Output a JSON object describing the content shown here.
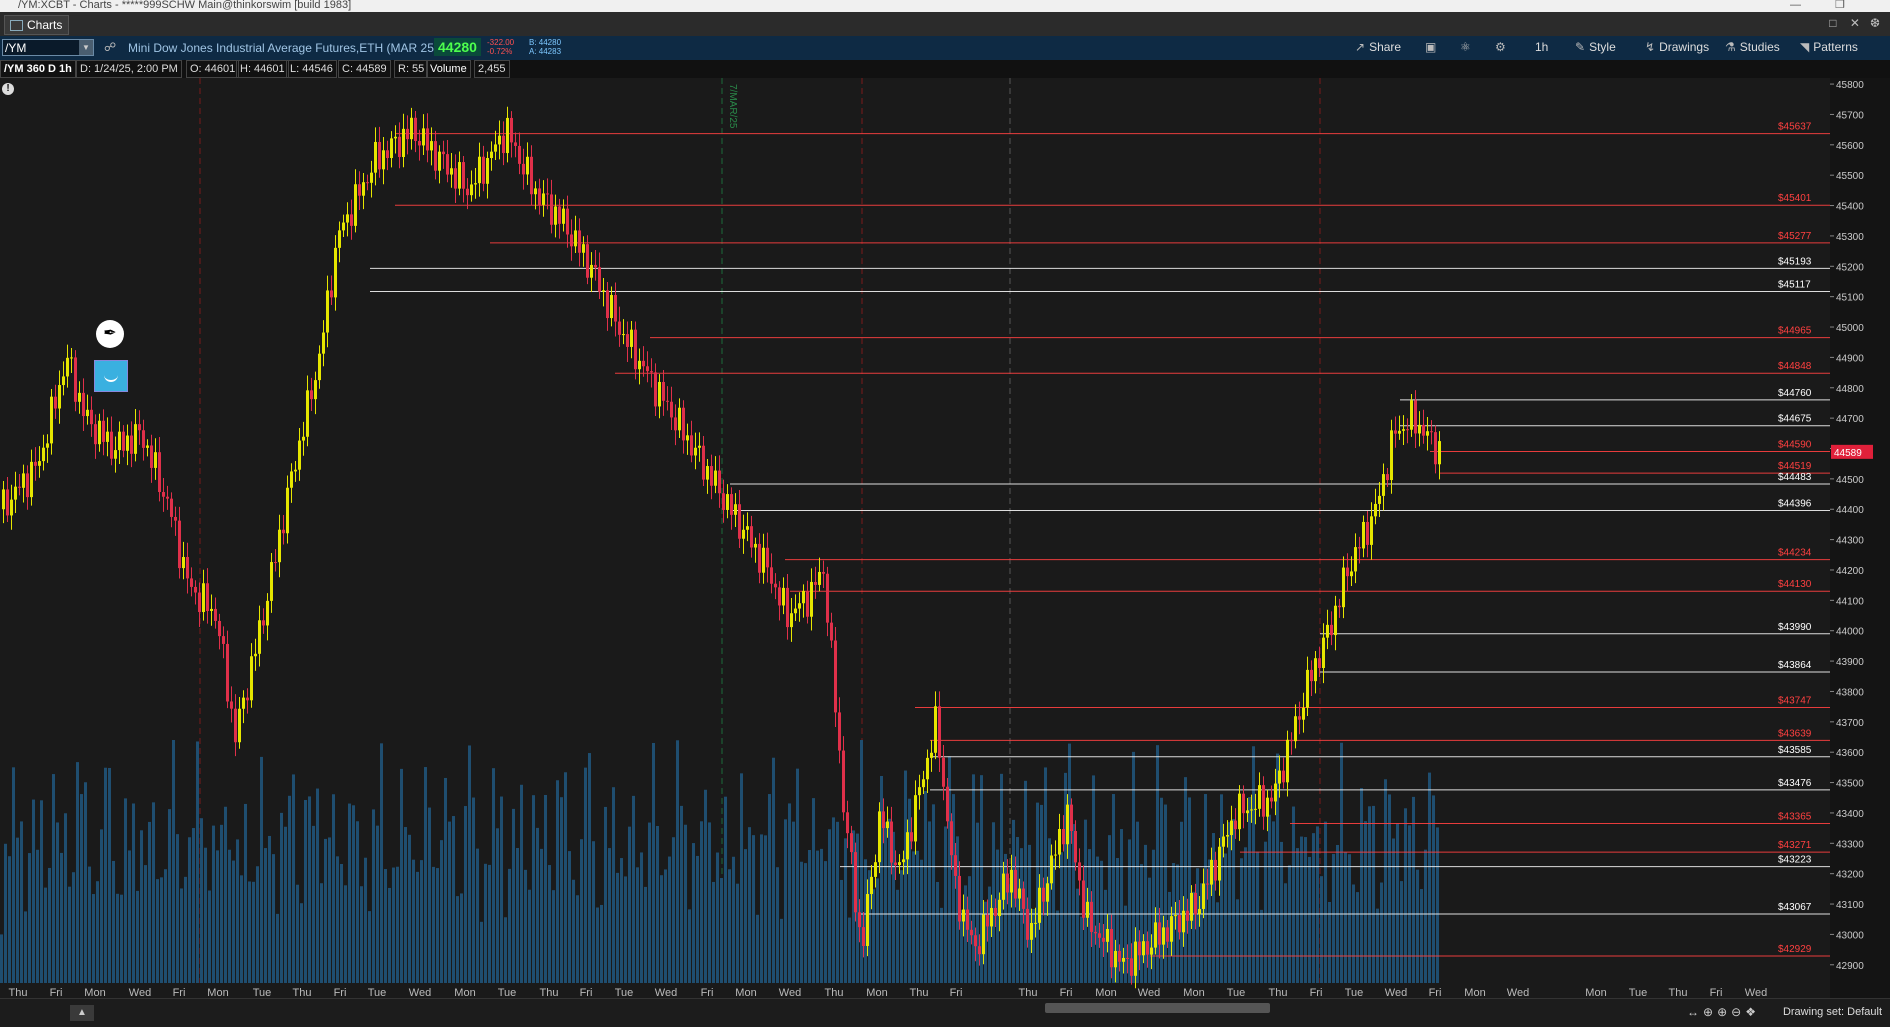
{
  "window": {
    "title": "/YM:XCBT - Charts - *****999SCHW Main@thinkorswim [build 1983]"
  },
  "tabs": [
    {
      "label": "Charts"
    }
  ],
  "toolbar": {
    "symbol": "/YM",
    "description": "Mini Dow Jones Industrial Average Futures,ETH (MAR 25)",
    "last_price": "44280",
    "net_change": "-322.00",
    "pct_change": "-0.72%",
    "bid": "B: 44280",
    "ask": "A: 44283",
    "share_label": "Share",
    "timeframe_label": "1h",
    "style_label": "Style",
    "drawings_label": "Drawings",
    "studies_label": "Studies",
    "patterns_label": "Patterns"
  },
  "status": {
    "chart_name": "/YM 360 D 1h",
    "date": "D: 1/24/25, 2:00 PM",
    "open": "O: 44601",
    "high": "H: 44601",
    "low": "L: 44546",
    "close": "C: 44589",
    "range": "R: 55",
    "volume_label": "Volume",
    "volume_value": "2,455"
  },
  "chart_data": {
    "type": "candlestick",
    "annotation": "7/MAR/25",
    "current_price": "44589",
    "ylim": [
      42840,
      45820
    ],
    "y_ticks": [
      "42900",
      "43000",
      "43100",
      "43200",
      "43300",
      "43400",
      "43500",
      "43600",
      "43700",
      "43800",
      "43900",
      "44000",
      "44100",
      "44200",
      "44300",
      "44400",
      "44500",
      "44600",
      "44700",
      "44800",
      "44900",
      "45000",
      "45100",
      "45200",
      "45300",
      "45400",
      "45500",
      "45600",
      "45700",
      "45800"
    ],
    "x_ticks": [
      "Thu",
      "Fri",
      "Mon",
      "Wed",
      "Fri",
      "Mon",
      "Tue",
      "Thu",
      "Fri",
      "Tue",
      "Wed",
      "Mon",
      "Tue",
      "Thu",
      "Fri",
      "Tue",
      "Wed",
      "Fri",
      "Mon",
      "Wed",
      "Thu",
      "Mon",
      "Thu",
      "Fri",
      "Thu",
      "Fri",
      "Mon",
      "Wed",
      "Mon",
      "Tue",
      "Thu",
      "Fri",
      "Tue",
      "Wed",
      "Fri",
      "Mon",
      "Wed",
      "Mon",
      "Tue",
      "Thu",
      "Fri",
      "Wed"
    ],
    "levels": [
      {
        "value": 45637,
        "label": "$45637",
        "color": "#ff4040"
      },
      {
        "value": 45401,
        "label": "$45401",
        "color": "#ff4040"
      },
      {
        "value": 45277,
        "label": "$45277",
        "color": "#ff4040"
      },
      {
        "value": 45193,
        "label": "$45193",
        "color": "#ffffff"
      },
      {
        "value": 45117,
        "label": "$45117",
        "color": "#ffffff"
      },
      {
        "value": 44965,
        "label": "$44965",
        "color": "#ff4040"
      },
      {
        "value": 44848,
        "label": "$44848",
        "color": "#ff4040"
      },
      {
        "value": 44760,
        "label": "$44760",
        "color": "#ffffff"
      },
      {
        "value": 44675,
        "label": "$44675",
        "color": "#ffffff"
      },
      {
        "value": 44590,
        "label": "$44590",
        "color": "#ff4040"
      },
      {
        "value": 44519,
        "label": "$44519",
        "color": "#ff4040"
      },
      {
        "value": 44483,
        "label": "$44483",
        "color": "#ffffff"
      },
      {
        "value": 44396,
        "label": "$44396",
        "color": "#ffffff"
      },
      {
        "value": 44234,
        "label": "$44234",
        "color": "#ff4040"
      },
      {
        "value": 44130,
        "label": "$44130",
        "color": "#ff4040"
      },
      {
        "value": 43990,
        "label": "$43990",
        "color": "#ffffff"
      },
      {
        "value": 43864,
        "label": "$43864",
        "color": "#ffffff"
      },
      {
        "value": 43747,
        "label": "$43747",
        "color": "#ff4040"
      },
      {
        "value": 43639,
        "label": "$43639",
        "color": "#ff4040"
      },
      {
        "value": 43585,
        "label": "$43585",
        "color": "#ffffff"
      },
      {
        "value": 43476,
        "label": "$43476",
        "color": "#ffffff"
      },
      {
        "value": 43365,
        "label": "$43365",
        "color": "#ff4040"
      },
      {
        "value": 43271,
        "label": "$43271",
        "color": "#ff4040"
      },
      {
        "value": 43223,
        "label": "$43223",
        "color": "#ffffff"
      },
      {
        "value": 43067,
        "label": "$43067",
        "color": "#ffffff"
      },
      {
        "value": 42929,
        "label": "$42929",
        "color": "#ff4040"
      }
    ],
    "price_path": [
      [
        0,
        44400
      ],
      [
        0.02,
        44550
      ],
      [
        0.035,
        44900
      ],
      [
        0.045,
        44700
      ],
      [
        0.06,
        44600
      ],
      [
        0.075,
        44650
      ],
      [
        0.09,
        44400
      ],
      [
        0.1,
        44150
      ],
      [
        0.115,
        44050
      ],
      [
        0.125,
        43650
      ],
      [
        0.14,
        44050
      ],
      [
        0.155,
        44500
      ],
      [
        0.17,
        44900
      ],
      [
        0.18,
        45300
      ],
      [
        0.2,
        45550
      ],
      [
        0.22,
        45650
      ],
      [
        0.235,
        45550
      ],
      [
        0.25,
        45450
      ],
      [
        0.27,
        45650
      ],
      [
        0.285,
        45450
      ],
      [
        0.3,
        45350
      ],
      [
        0.315,
        45200
      ],
      [
        0.33,
        45000
      ],
      [
        0.35,
        44800
      ],
      [
        0.37,
        44600
      ],
      [
        0.39,
        44400
      ],
      [
        0.41,
        44200
      ],
      [
        0.42,
        44050
      ],
      [
        0.43,
        44100
      ],
      [
        0.44,
        44200
      ],
      [
        0.45,
        43450
      ],
      [
        0.46,
        42950
      ],
      [
        0.47,
        43400
      ],
      [
        0.48,
        43200
      ],
      [
        0.5,
        43700
      ],
      [
        0.51,
        43150
      ],
      [
        0.52,
        42950
      ],
      [
        0.54,
        43200
      ],
      [
        0.55,
        43000
      ],
      [
        0.57,
        43400
      ],
      [
        0.58,
        43050
      ],
      [
        0.6,
        42900
      ],
      [
        0.62,
        43000
      ],
      [
        0.64,
        43100
      ],
      [
        0.66,
        43400
      ],
      [
        0.68,
        43450
      ],
      [
        0.69,
        43650
      ],
      [
        0.7,
        43850
      ],
      [
        0.71,
        44000
      ],
      [
        0.72,
        44200
      ],
      [
        0.735,
        44400
      ],
      [
        0.745,
        44650
      ],
      [
        0.755,
        44700
      ],
      [
        0.765,
        44620
      ],
      [
        0.77,
        44589
      ]
    ],
    "volume_relative": [
      0.4,
      0.7,
      0.5,
      0.8,
      0.6,
      0.9,
      0.5,
      0.6,
      0.7,
      0.5,
      0.8,
      0.6,
      0.7,
      0.9,
      0.6,
      0.5,
      0.8,
      0.7,
      0.6,
      0.9,
      0.7,
      0.8,
      0.6,
      0.7,
      0.5,
      0.6,
      0.8,
      0.9,
      0.7,
      0.6
    ]
  },
  "bottom": {
    "drawing_set": "Drawing set: Default"
  }
}
